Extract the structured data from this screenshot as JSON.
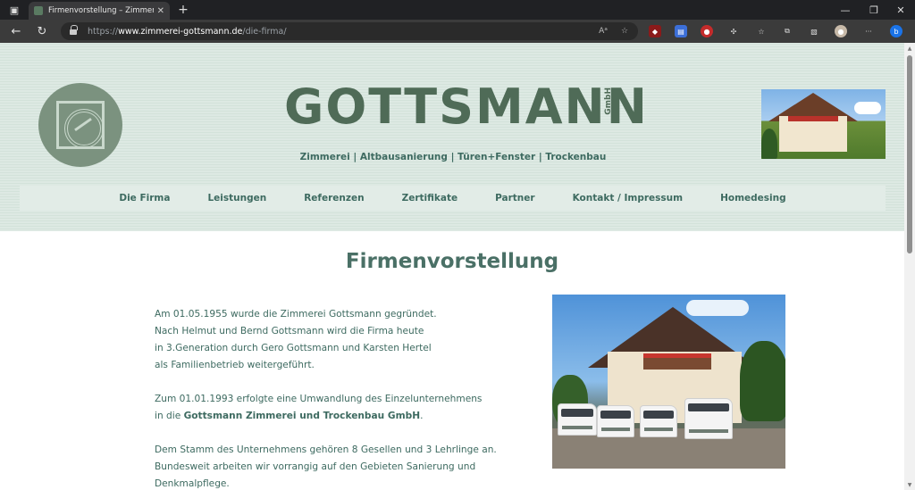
{
  "browser": {
    "tab_title": "Firmenvorstellung – Zimmerei Go",
    "tab_close": "✕",
    "new_tab": "+",
    "url_scheme": "https://",
    "url_host": "www.zimmerei-gottsmann.de",
    "url_path": "/die-firma/",
    "icons": [
      "sidebar-icon",
      "back-icon",
      "reload-icon",
      "lock-icon",
      "read-aloud-icon",
      "add-favorite-icon",
      "ublock-icon",
      "translate-icon",
      "extension-icon",
      "puzzle-icon",
      "favorites-icon",
      "collections-icon",
      "screenshot-icon",
      "profile-icon",
      "more-icon",
      "bing-icon"
    ],
    "window_controls": [
      "—",
      "❐",
      "✕"
    ]
  },
  "header": {
    "brand": "GOTTSMANN",
    "brand_suffix": "GmbH",
    "tagline": "Zimmerei | Altbausanierung | Türen+Fenster | Trockenbau",
    "colors": {
      "brand": "#4f6b57",
      "accent": "#3d6a60",
      "header_bg": "#d9e6df"
    }
  },
  "nav": {
    "items": [
      {
        "label": "Die Firma"
      },
      {
        "label": "Leistungen"
      },
      {
        "label": "Referenzen"
      },
      {
        "label": "Zertifikate"
      },
      {
        "label": "Partner"
      },
      {
        "label": "Kontakt / Impressum"
      },
      {
        "label": "Homedesing"
      }
    ]
  },
  "content": {
    "title": "Firmenvorstellung",
    "p1": [
      "Am 01.05.1955 wurde die Zimmerei Gottsmann gegründet.",
      "Nach Helmut und Bernd Gottsmann wird die Firma heute",
      "in 3.Generation durch Gero Gottsmann und Karsten Hertel",
      "als Familienbetrieb weitergeführt."
    ],
    "p2_line1": "Zum 01.01.1993 erfolgte eine Umwandlung des Einzelunternehmens",
    "p2_line2_prefix": "in die ",
    "p2_line2_bold": "Gottsmann Zimmerei und Trockenbau GmbH",
    "p2_line2_suffix": ".",
    "p3": [
      "Dem Stamm des Unternehmens gehören 8 Gesellen und 3 Lehrlinge an.",
      "Bundesweit arbeiten wir vorrangig auf den Gebieten Sanierung und",
      "Denkmalpflege."
    ]
  }
}
